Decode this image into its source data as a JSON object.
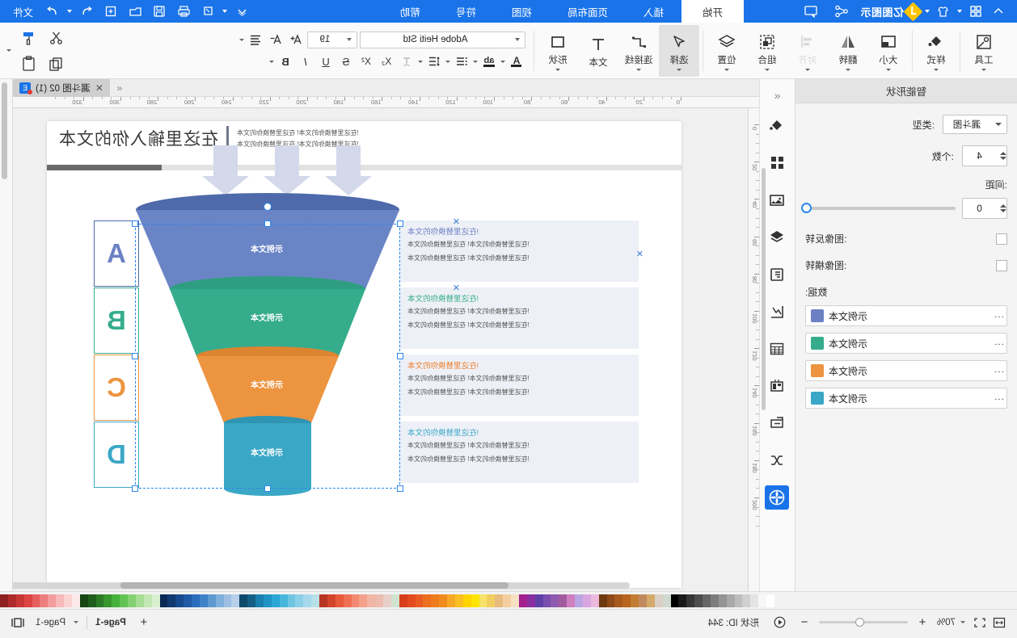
{
  "app": {
    "brand_name": "亿图图示",
    "topbar_icons": [
      "collapse-icon",
      "grid-apps-icon",
      "shirt-icon",
      "share-nodes-icon",
      "comment-icon"
    ],
    "right_icons": [
      "account-icon",
      "touch-icon",
      "print-icon",
      "save-icon",
      "open-icon",
      "new-icon",
      "undo-icon",
      "redo-icon"
    ],
    "file_menu_label": "文件"
  },
  "menu": {
    "items": [
      {
        "label": "开始",
        "active": true
      },
      {
        "label": "插入",
        "active": false
      },
      {
        "label": "页面布局",
        "active": false
      },
      {
        "label": "视图",
        "active": false
      },
      {
        "label": "符号",
        "active": false
      },
      {
        "label": "帮助",
        "active": false
      }
    ]
  },
  "ribbon": {
    "groups": [
      {
        "label": "工具",
        "icon": "tools-icon",
        "selected": false,
        "disabled": false,
        "dropdown": true
      },
      {
        "label": "样式",
        "icon": "paint-bucket-icon",
        "selected": false,
        "disabled": false,
        "dropdown": true
      },
      {
        "label": "大小",
        "icon": "size-icon",
        "selected": false,
        "disabled": false,
        "dropdown": true
      },
      {
        "label": "翻转",
        "icon": "flip-icon",
        "selected": false,
        "disabled": false,
        "dropdown": true
      },
      {
        "label": "对齐",
        "icon": "align-icon",
        "selected": false,
        "disabled": true,
        "dropdown": true
      },
      {
        "label": "组合",
        "icon": "group-icon",
        "selected": false,
        "disabled": false,
        "dropdown": true
      },
      {
        "label": "位置",
        "icon": "layers-icon",
        "selected": false,
        "disabled": false,
        "dropdown": true
      },
      {
        "label": "选择",
        "icon": "cursor-arrow-icon",
        "selected": true,
        "disabled": false,
        "dropdown": true
      },
      {
        "label": "连接线",
        "icon": "connector-icon",
        "selected": false,
        "disabled": false,
        "dropdown": true
      },
      {
        "label": "文本",
        "icon": "text-icon",
        "selected": false,
        "disabled": false,
        "dropdown": false
      },
      {
        "label": "形状",
        "icon": "shape-icon",
        "selected": false,
        "disabled": false,
        "dropdown": true
      }
    ],
    "font": {
      "family": "Adobe Heiti Std",
      "size": "19",
      "grow_icon": "increase-font-size-icon",
      "shrink_icon": "decrease-font-size-icon",
      "align_icon": "paragraph-align-icon"
    },
    "format_buttons": [
      {
        "name": "bold-button",
        "glyph": "B"
      },
      {
        "name": "italic-button",
        "glyph": "I"
      },
      {
        "name": "underline-button",
        "glyph": "U"
      },
      {
        "name": "strikethrough-button",
        "glyph": "S"
      },
      {
        "name": "superscript-button",
        "glyph": "X²"
      },
      {
        "name": "subscript-button",
        "glyph": "X₂"
      },
      {
        "name": "clear-format-button",
        "glyph": "T"
      },
      {
        "name": "line-spacing-button",
        "glyph": "≡"
      },
      {
        "name": "list-button",
        "glyph": "≔"
      },
      {
        "name": "highlight-color-button",
        "glyph": "ab"
      },
      {
        "name": "font-color-button",
        "glyph": "A"
      }
    ],
    "far_buttons": [
      {
        "name": "scissors-button",
        "icon": "scissors-icon"
      },
      {
        "name": "format-painter-button",
        "icon": "brush-icon"
      },
      {
        "name": "paste-button",
        "icon": "clipboard-icon"
      },
      {
        "name": "copy-button",
        "icon": "copy-icon"
      }
    ]
  },
  "panel": {
    "title": "智能形状",
    "type_label": "类型:",
    "type_value": "漏斗图",
    "count_label": "个数:",
    "count_value": "4",
    "spacing_label": "间距:",
    "spacing_value": "0",
    "flip_vertical_label": "图像反转:",
    "flip_horizontal_label": "图像横转:",
    "data_label": "数据:",
    "data_rows": [
      {
        "text": "示例文本",
        "color": "#6b81c4"
      },
      {
        "text": "示例文本",
        "color": "#35ad8c"
      },
      {
        "text": "示例文本",
        "color": "#ec9440"
      },
      {
        "text": "示例文本",
        "color": "#3ba7c6"
      }
    ]
  },
  "rail": {
    "collapse_icon": "chevron-double-left-icon",
    "items": [
      {
        "name": "fill-icon",
        "active": false
      },
      {
        "name": "symbols-grid-icon",
        "active": false
      },
      {
        "name": "image-icon",
        "active": false
      },
      {
        "name": "layers-icon",
        "active": false
      },
      {
        "name": "notes-icon",
        "active": false
      },
      {
        "name": "chart-icon",
        "active": false
      },
      {
        "name": "table-icon",
        "active": false
      },
      {
        "name": "widget-icon",
        "active": false
      },
      {
        "name": "container-icon",
        "active": false
      },
      {
        "name": "shuffle-icon",
        "active": false
      },
      {
        "name": "smart-shape-icon",
        "active": true
      }
    ]
  },
  "document": {
    "tab_title": "漏斗图 02 (1)",
    "close_label": "✕",
    "chevron_label": "«"
  },
  "canvas": {
    "header_title": "在这里输入你的文本",
    "header_sublines": [
      "在这里替换你的文本!  在这里替换你的文本!",
      "在这里替换你的文本!  在这里替换你的文本!"
    ],
    "sections": [
      {
        "letter": "A",
        "color": "#6b81c4",
        "heading": "在这里替换你的文本!",
        "lines": [
          "在这里替换你的文本!  在这里替换你的文本!",
          "在这里替换你的文本!  在这里替换你的文本!"
        ],
        "funnel_label": "示例文本"
      },
      {
        "letter": "B",
        "color": "#35ad8c",
        "heading": "在这里替换你的文本!",
        "lines": [
          "在这里替换你的文本!  在这里替换你的文本!",
          "在这里替换你的文本!  在这里替换你的文本!"
        ],
        "funnel_label": "示例文本"
      },
      {
        "letter": "C",
        "color": "#ec9440",
        "heading": "在这里替换你的文本!",
        "lines": [
          "在这里替换你的文本!  在这里替换你的文本!",
          "在这里替换你的文本!  在这里替换你的文本!"
        ],
        "funnel_label": "示例文本"
      },
      {
        "letter": "D",
        "color": "#3ba7c6",
        "heading": "在这里替换你的文本!",
        "lines": [
          "在这里替换你的文本!  在这里替换你的文本!",
          "在这里替换你的文本!  在这里替换你的文本!"
        ],
        "funnel_label": "示例文本"
      }
    ],
    "ruler_top_ticks": [
      "0",
      "20",
      "40",
      "60",
      "80",
      "100",
      "120",
      "140",
      "160",
      "180",
      "200",
      "220",
      "240",
      "260",
      "280",
      "300",
      "320"
    ],
    "ruler_left_ticks": [
      "0",
      "20",
      "40",
      "60",
      "80",
      "100",
      "120",
      "140",
      "160",
      "180",
      "200"
    ]
  },
  "statusbar": {
    "shape_id": "形状 ID: 344",
    "zoom_value": "70%",
    "fit_icon": "fit-page-icon",
    "fullscreen_icon": "fullscreen-icon",
    "zoom_out": "−",
    "zoom_in": "+",
    "prev_page_icon": "prev-page-icon",
    "page_current": "Page-1",
    "page_selector": "Page-1",
    "add_page": "+",
    "view_mode_icon": "view-mode-icon"
  },
  "palette": {
    "colors": [
      "#ffffff",
      "#f7f7f7",
      "#e4e4e4",
      "#d0d0d0",
      "#bdbdbd",
      "#a8a8a8",
      "#949494",
      "#7d7d7d",
      "#666666",
      "#4e4e4e",
      "#363636",
      "#1a1a1a",
      "#000000",
      "#cfd8cf",
      "#d9cfc4",
      "#d4a96a",
      "#c08a5e",
      "#c27d33",
      "#b8641f",
      "#a85a1c",
      "#8c4a18",
      "#6e3a12",
      "#eab9dd",
      "#d9a7e0",
      "#b9a6e2",
      "#cf7fc0",
      "#a35ba0",
      "#8f5bb0",
      "#7b4fae",
      "#5f3fa8",
      "#8a2fa0",
      "#a21f8d",
      "#f7e0c4",
      "#f5cfa0",
      "#e8bb7f",
      "#f0cf60",
      "#f6e267",
      "#ffe400",
      "#ffd400",
      "#fbbf24",
      "#f7a826",
      "#f08c1e",
      "#ee7b1c",
      "#ec6f1f",
      "#ea5b24",
      "#e34a1f",
      "#d63f1a",
      "#cfe3cf",
      "#e8cfc9",
      "#ecbcae",
      "#f2b6a4",
      "#f4a18b",
      "#f28a72",
      "#ef7155",
      "#e85a3a",
      "#d3452a",
      "#b83423",
      "#b7e0e8",
      "#a6d9ec",
      "#8ccfe8",
      "#6fc4e2",
      "#49b6dc",
      "#2aa7d4",
      "#1f94c4",
      "#1a7fae",
      "#155f86",
      "#0e4a6b",
      "#b7cfe8",
      "#9dbfe2",
      "#7fafdc",
      "#5f99d2",
      "#3f82c8",
      "#2a6dbd",
      "#1f5aa6",
      "#174a8c",
      "#103a70",
      "#0a2a55",
      "#d9f0d0",
      "#c2e8b4",
      "#a6dd94",
      "#86d074",
      "#63c255",
      "#46b13b",
      "#37962e",
      "#2b7a26",
      "#1f5e1c",
      "#164614",
      "#fde9e9",
      "#fad2d2",
      "#f7b9b9",
      "#f39c9c",
      "#ee7d7d",
      "#e85f5f",
      "#dd4444",
      "#c93636",
      "#ae2b2b",
      "#8f2121"
    ]
  }
}
